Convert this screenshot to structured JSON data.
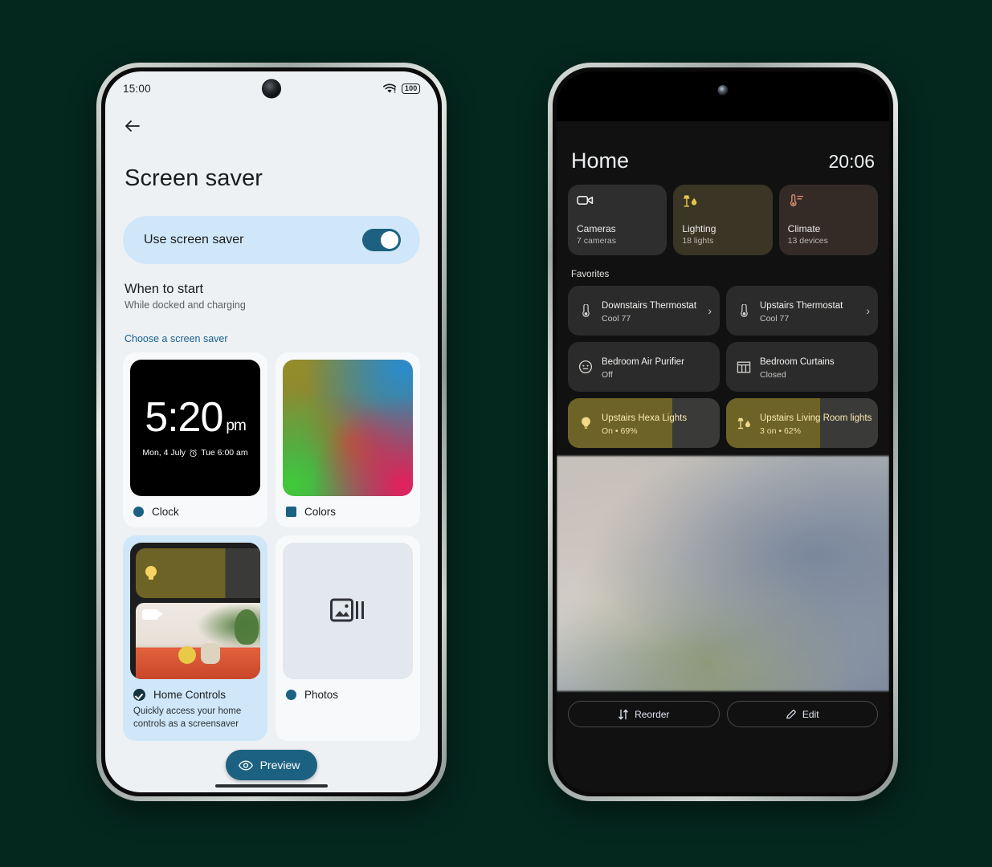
{
  "background_color": "#04271e",
  "left_phone": {
    "status_bar": {
      "time": "15:00",
      "wifi_icon": "wifi-alert-icon",
      "battery_level": "100"
    },
    "back_icon": "back-arrow-icon",
    "page_title": "Screen saver",
    "toggle": {
      "label": "Use screen saver",
      "state": "on"
    },
    "when_to_start": {
      "title": "When to start",
      "subtitle": "While docked and charging"
    },
    "choose_label": "Choose a screen saver",
    "screensavers": [
      {
        "name": "Clock",
        "marker": "dot",
        "selected": false,
        "preview": {
          "time": "5:20",
          "ampm": "pm",
          "date": "Mon, 4 July",
          "alarm_icon": "alarm-clock-icon",
          "alarm": "Tue 6:00 am"
        }
      },
      {
        "name": "Colors",
        "marker": "square",
        "selected": false
      },
      {
        "name": "Home Controls",
        "marker": "check",
        "selected": true,
        "description": "Quickly access your home controls as a screensaver",
        "preview": {
          "light_icon": "light-bulb-icon",
          "camera_icon": "video-camera-icon"
        }
      },
      {
        "name": "Photos",
        "marker": "dot",
        "selected": false,
        "preview": {
          "icon": "photo-gallery-icon"
        }
      }
    ],
    "preview_button": {
      "label": "Preview",
      "icon": "eye-icon"
    }
  },
  "right_phone": {
    "header": {
      "title": "Home",
      "clock": "20:06"
    },
    "categories": [
      {
        "name": "Cameras",
        "sub": "7 cameras",
        "icon": "video-camera-icon",
        "bg": "#2e2e2e",
        "icon_color": "#e8eaed"
      },
      {
        "name": "Lighting",
        "sub": "18 lights",
        "icon": "lamp-icon",
        "bg": "#3a3524",
        "icon_color": "#e9c44c"
      },
      {
        "name": "Climate",
        "sub": "13 devices",
        "icon": "thermometer-icon",
        "bg": "#342a26",
        "icon_color": "#d78a72"
      }
    ],
    "favorites_label": "Favorites",
    "favorites": [
      {
        "name": "Downstairs Thermostat",
        "state": "Cool 77",
        "icon": "thermostat-icon",
        "has_chevron": true,
        "lit": false,
        "fill_percent": 0
      },
      {
        "name": "Upstairs Thermostat",
        "state": "Cool 77",
        "icon": "thermostat-icon",
        "has_chevron": true,
        "lit": false,
        "fill_percent": 0
      },
      {
        "name": "Bedroom Air Purifier",
        "state": "Off",
        "icon": "air-purifier-icon",
        "has_chevron": false,
        "lit": false,
        "fill_percent": 0
      },
      {
        "name": "Bedroom Curtains",
        "state": "Closed",
        "icon": "curtains-icon",
        "has_chevron": false,
        "lit": false,
        "fill_percent": 0
      },
      {
        "name": "Upstairs Hexa Lights",
        "state": "On • 69%",
        "icon": "light-bulb-icon",
        "has_chevron": false,
        "lit": true,
        "fill_percent": 69
      },
      {
        "name": "Upstairs Living Room lights",
        "state": "3 on • 62%",
        "icon": "lamp-icon",
        "has_chevron": false,
        "lit": true,
        "fill_percent": 62
      }
    ],
    "camera_feed": {
      "name": "camera-feed-preview"
    },
    "buttons": [
      {
        "label": "Reorder",
        "icon": "reorder-icon"
      },
      {
        "label": "Edit",
        "icon": "pencil-icon"
      }
    ]
  }
}
